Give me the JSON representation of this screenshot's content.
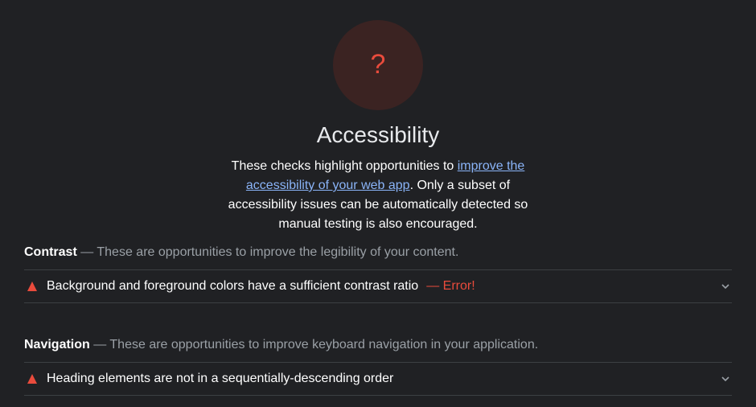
{
  "category": {
    "score_glyph": "?",
    "title": "Accessibility",
    "description_before": "These checks highlight opportunities to ",
    "description_link": "improve the accessibility of your web app",
    "description_after": ". Only a subset of accessibility issues can be automatically detected so manual testing is also encouraged."
  },
  "groups": [
    {
      "title": "Contrast",
      "description": " — These are opportunities to improve the legibility of your content.",
      "audits": [
        {
          "title": "Background and foreground colors have a sufficient contrast ratio",
          "error": "— Error!"
        }
      ]
    },
    {
      "title": "Navigation",
      "description": " — These are opportunities to improve keyboard navigation in your application.",
      "audits": [
        {
          "title": "Heading elements are not in a sequentially-descending order",
          "error": ""
        }
      ]
    }
  ],
  "icons": {
    "fail": "warning-triangle-icon",
    "expand": "chevron-down-icon"
  },
  "colors": {
    "background": "#202124",
    "fail": "#e94b3c",
    "gauge_fill": "#3b2322",
    "link": "#8ab4f8",
    "muted": "#9aa0a6"
  }
}
